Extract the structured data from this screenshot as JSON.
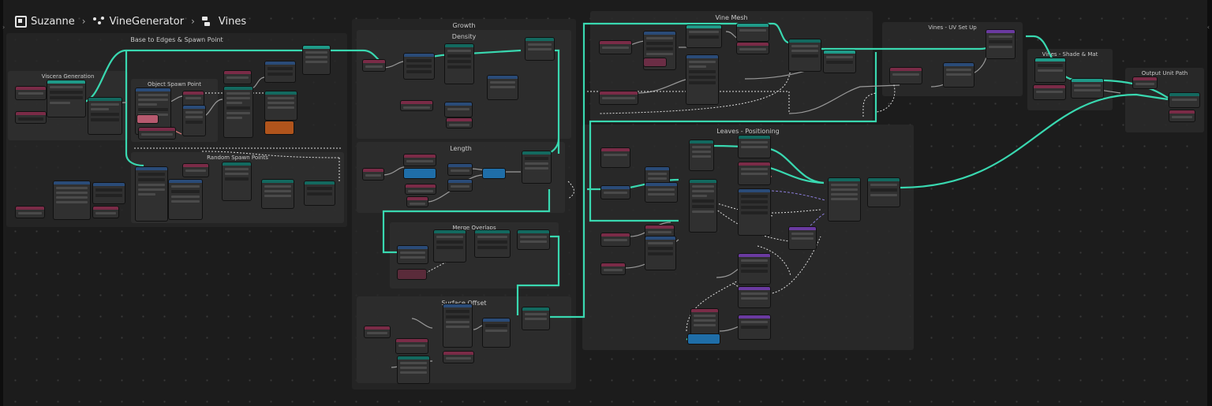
{
  "breadcrumb": {
    "object": "Suzanne",
    "modifier": "VineGenerator",
    "node_tree": "Vines"
  },
  "icons": {
    "object": "mesh-object-icon",
    "modifier": "geometry-nodes-modifier-icon",
    "node_tree": "node-tree-icon",
    "separator": "chevron-right-icon"
  },
  "frames": {
    "base": "Base to Edges & Spawn Point",
    "viscera": "Viscera Generation",
    "spawn_point": "Object Spawn Point",
    "random_spawn": "Random Spawn Points",
    "growth": "Growth",
    "density": "Density",
    "length": "Length",
    "merge": "Merge Overlaps",
    "surface": "Surface Offset",
    "vine_mesh": "Vine Mesh",
    "uv": "Vines - UV Set Up",
    "shade": "Vines - Shade & Mat",
    "leaves": "Leaves - Positioning",
    "output": "Output Unit Path"
  },
  "colors": {
    "canvas": "#1c1c1c",
    "wire_main": "#39d8b0",
    "wire_data": "#a8a8a8",
    "wire_field": "#8a7cd8",
    "header_group": "#1f9a88",
    "header_input": "#7a2b47",
    "header_geometry": "#13695f",
    "header_converter": "#2a4b78"
  }
}
